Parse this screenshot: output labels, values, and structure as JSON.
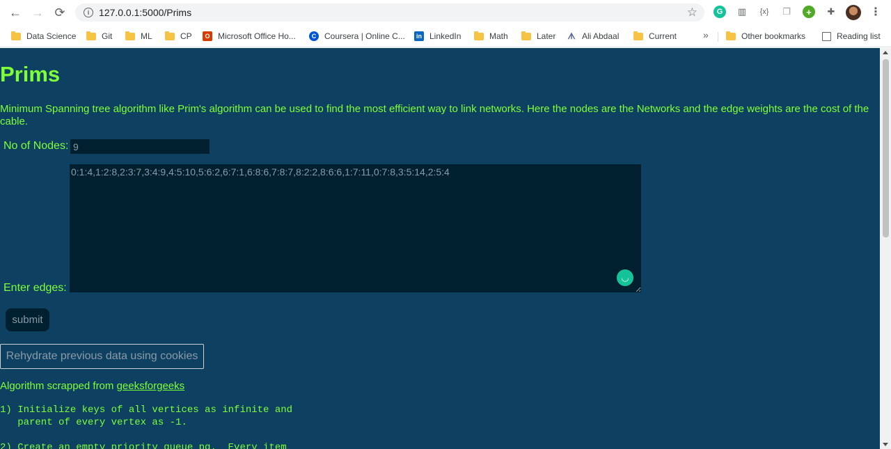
{
  "browser": {
    "url": "127.0.0.1:5000/Prims",
    "bookmarks": [
      {
        "label": "Data Science",
        "icon": "folder-icon"
      },
      {
        "label": "Git",
        "icon": "folder-icon"
      },
      {
        "label": "ML",
        "icon": "folder-icon"
      },
      {
        "label": "CP",
        "icon": "folder-icon"
      },
      {
        "label": "Microsoft Office Ho...",
        "icon": "office-icon"
      },
      {
        "label": "Coursera | Online C...",
        "icon": "coursera-icon"
      },
      {
        "label": "LinkedIn",
        "icon": "linkedin-icon"
      },
      {
        "label": "Math",
        "icon": "folder-icon"
      },
      {
        "label": "Later",
        "icon": "folder-icon"
      },
      {
        "label": "Ali Abdaal",
        "icon": "ali-abdaal-icon"
      },
      {
        "label": "Current",
        "icon": "folder-icon"
      }
    ],
    "overflow": "»",
    "other_bookmarks": "Other bookmarks",
    "reading_list": "Reading list"
  },
  "page": {
    "title": "Prims",
    "description": "Minimum Spanning tree algorithm like Prim's algorithm can be used to find the most efficient way to link networks. Here the nodes are the Networks and the edge weights are the cost of the cable.",
    "nodes_label": "No of Nodes:",
    "nodes_value": "9",
    "edges_label": "Enter edges:",
    "edges_value": "0:1:4,1:2:8,2:3:7,3:4:9,4:5:10,5:6:2,6:7:1,6:8:6,7:8:7,8:2:2,8:6:6,1:7:11,0:7:8,3:5:14,2:5:4",
    "submit_label": "submit",
    "rehydrate_label": "Rehydrate previous data using cookies",
    "algo_prefix": "Algorithm scrapped from ",
    "algo_link": "geeksforgeeks",
    "steps": "1) Initialize keys of all vertices as infinite and\n   parent of every vertex as -1.\n\n2) Create an empty priority_queue pq.  Every item"
  },
  "colors": {
    "page_bg": "#0e4061",
    "accent_text": "#7fff37",
    "input_bg": "#01202f"
  }
}
